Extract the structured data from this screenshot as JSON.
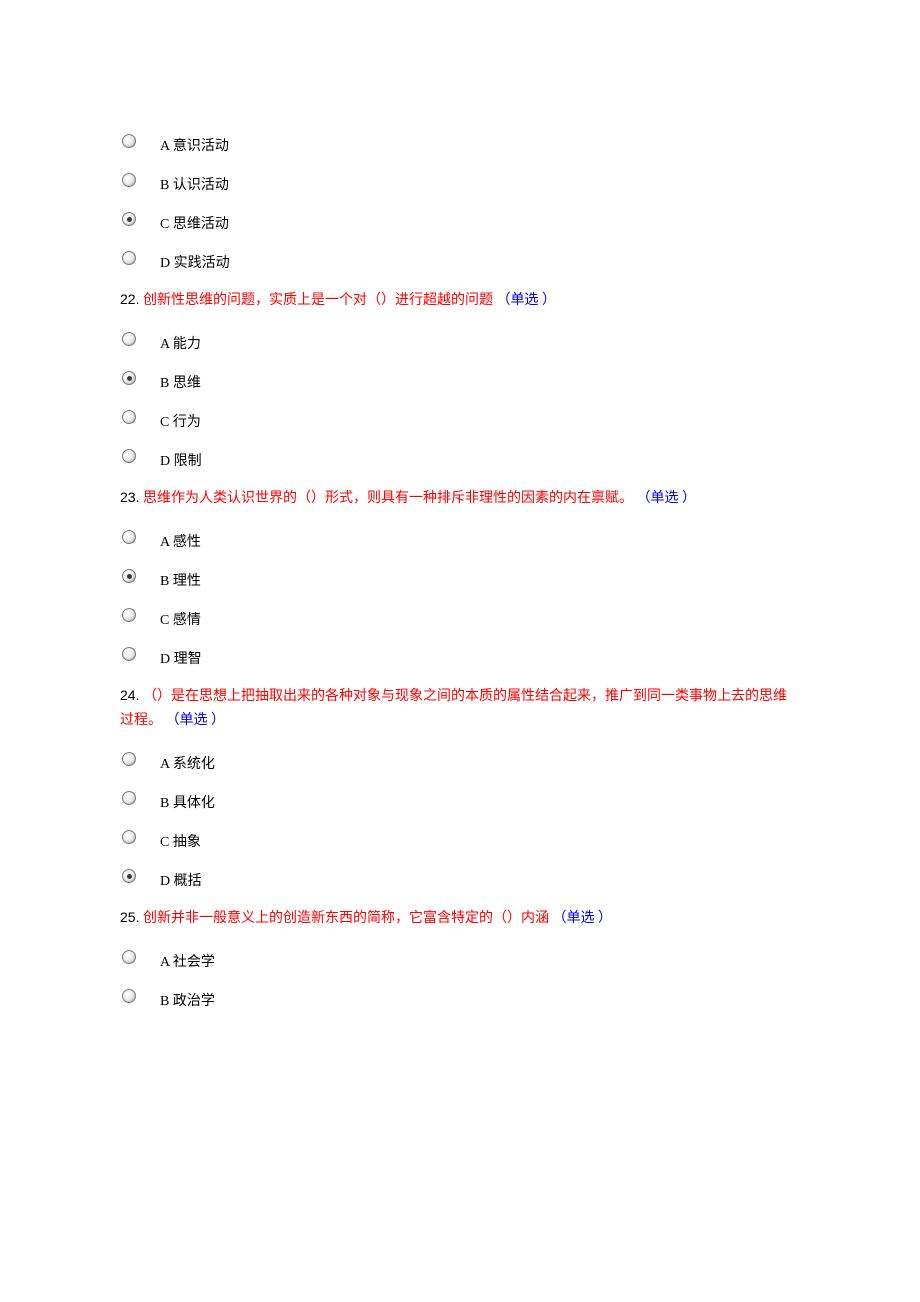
{
  "pre_options": [
    {
      "label": "A 意识活动",
      "selected": false
    },
    {
      "label": "B 认识活动",
      "selected": false
    },
    {
      "label": "C 思维活动",
      "selected": true
    },
    {
      "label": "D 实践活动",
      "selected": false
    }
  ],
  "questions": [
    {
      "num": "22.",
      "main_red": "创新性思维的问题，实质上是一个对（）进行超越的问题",
      "main_black_tail": "",
      "hint": "（单选 ）",
      "options": [
        {
          "label": "A 能力",
          "selected": false
        },
        {
          "label": "B 思维",
          "selected": true
        },
        {
          "label": "C 行为",
          "selected": false
        },
        {
          "label": "D 限制",
          "selected": false
        }
      ]
    },
    {
      "num": "23.",
      "main_red": "思维作为人类认识世界的（）形式，则具有一种排斥非理性的因素的内在禀赋。",
      "main_black_tail": "",
      "hint": "（单选 ）",
      "options": [
        {
          "label": "A 感性",
          "selected": false
        },
        {
          "label": "B 理性",
          "selected": true
        },
        {
          "label": "C 感情",
          "selected": false
        },
        {
          "label": "D 理智",
          "selected": false
        }
      ]
    },
    {
      "num": "24.",
      "main_red": "（）是在思想上把抽取出来的各种对象与现象之间的本质的属性结合起来，推广到同一类事物上去的思维过程。",
      "main_black_tail": "",
      "hint": "（单选 ）",
      "options": [
        {
          "label": "A 系统化",
          "selected": false
        },
        {
          "label": "B 具体化",
          "selected": false
        },
        {
          "label": "C 抽象",
          "selected": false
        },
        {
          "label": "D 概括",
          "selected": true
        }
      ]
    },
    {
      "num": "25.",
      "main_red": "创新并非一般意义上的创造新东西的简称，它富含特定的（）内涵",
      "main_black_tail": "",
      "hint": "（单选 ）",
      "options": [
        {
          "label": "A 社会学",
          "selected": false
        },
        {
          "label": "B 政治学",
          "selected": false
        }
      ]
    }
  ]
}
